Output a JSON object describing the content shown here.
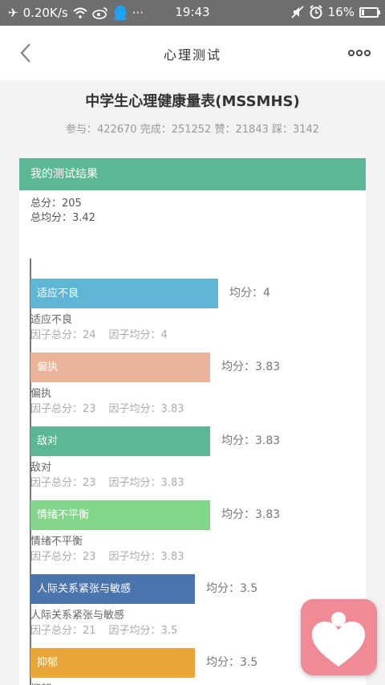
{
  "status_bar": {
    "left": {
      "net_speed": "0.20K/s"
    },
    "time": "19:43",
    "battery": "16%",
    "battery_level": 0.16
  },
  "nav": {
    "title": "心理测试"
  },
  "header": {
    "title": "中学生心理健康量表(MSSMHS)",
    "stats": "参与：422670 完成：251252 赞：21843 踩：3142"
  },
  "result": {
    "heading": "我的测试结果",
    "total_label": "总分：205",
    "avg_label": "总均分：3.42"
  },
  "chart_data": {
    "type": "bar",
    "orientation": "horizontal",
    "categories": [
      "适应不良",
      "偏执",
      "敌对",
      "情绪不平衡",
      "人际关系紧张与敏感",
      "抑郁"
    ],
    "values": [
      4,
      3.83,
      3.83,
      3.83,
      3.5,
      3.5
    ],
    "colors": [
      "#5fb5d4",
      "#e9b39a",
      "#5cb795",
      "#82d58b",
      "#4b73ad",
      "#eba63a"
    ]
  },
  "factors": [
    {
      "name": "适应不良",
      "bar_label": "适应不良",
      "avg": "均分：4",
      "total": "因子总分：24",
      "mean": "因子均分：4"
    },
    {
      "name": "偏执",
      "bar_label": "偏执",
      "avg": "均分：3.83",
      "total": "因子总分：23",
      "mean": "因子均分：3.83"
    },
    {
      "name": "敌对",
      "bar_label": "敌对",
      "avg": "均分：3.83",
      "total": "因子总分：23",
      "mean": "因子均分：3.83"
    },
    {
      "name": "情绪不平衡",
      "bar_label": "情绪不平衡",
      "avg": "均分：3.83",
      "total": "因子总分：23",
      "mean": "因子均分：3.83"
    },
    {
      "name": "人际关系紧张与敏感",
      "bar_label": "人际关系紧张与敏感",
      "avg": "均分：3.5",
      "total": "因子总分：21",
      "mean": "因子均分：3.5"
    },
    {
      "name": "抑郁",
      "bar_label": "抑郁",
      "avg": "均分：3.5"
    }
  ]
}
